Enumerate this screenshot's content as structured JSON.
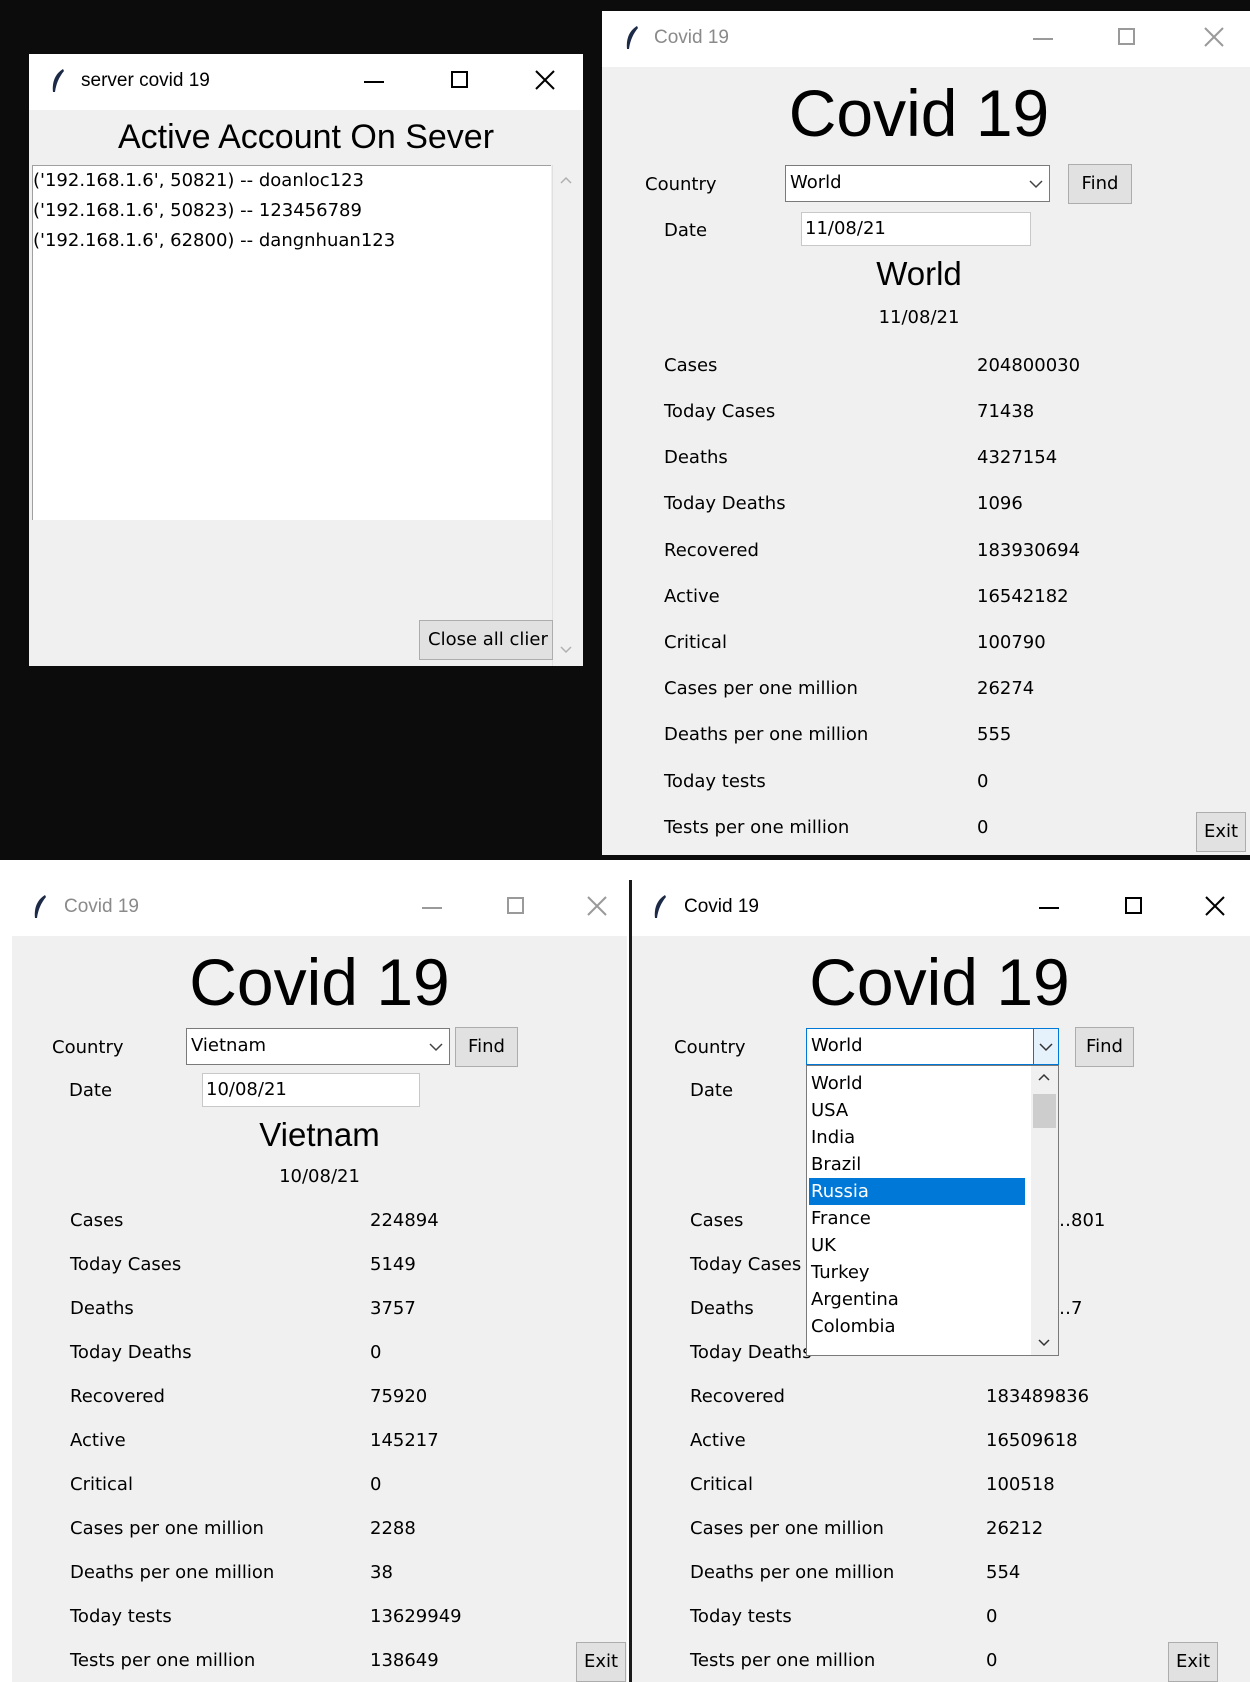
{
  "server_window": {
    "title": "server covid 19",
    "heading": "Active Account On Sever",
    "clients": [
      "('192.168.1.6', 50821) -- doanloc123",
      "('192.168.1.6', 50823) -- 123456789",
      "('192.168.1.6', 62800) -- dangnhuan123"
    ],
    "close_button": "Close all clier"
  },
  "client_top": {
    "title": "Covid 19",
    "heading": "Covid 19",
    "country_label": "Country",
    "country_value": "World",
    "find_button": "Find",
    "date_label": "Date",
    "date_value": "11/08/21",
    "result_name": "World",
    "result_date": "11/08/21",
    "stats": [
      {
        "label": "Cases",
        "value": "204800030"
      },
      {
        "label": "Today Cases",
        "value": "71438"
      },
      {
        "label": "Deaths",
        "value": "4327154"
      },
      {
        "label": "Today Deaths",
        "value": "1096"
      },
      {
        "label": "Recovered",
        "value": "183930694"
      },
      {
        "label": "Active",
        "value": "16542182"
      },
      {
        "label": "Critical",
        "value": "100790"
      },
      {
        "label": "Cases per one million",
        "value": "26274"
      },
      {
        "label": "Deaths per one million",
        "value": "555"
      },
      {
        "label": "Today tests",
        "value": "0"
      },
      {
        "label": "Tests per one million",
        "value": "0"
      }
    ],
    "exit_button": "Exit"
  },
  "client_bl": {
    "title": "Covid 19",
    "heading": "Covid 19",
    "country_label": "Country",
    "country_value": "Vietnam",
    "find_button": "Find",
    "date_label": "Date",
    "date_value": "10/08/21",
    "result_name": "Vietnam",
    "result_date": "10/08/21",
    "stats": [
      {
        "label": "Cases",
        "value": "224894"
      },
      {
        "label": "Today Cases",
        "value": "5149"
      },
      {
        "label": "Deaths",
        "value": "3757"
      },
      {
        "label": "Today Deaths",
        "value": "0"
      },
      {
        "label": "Recovered",
        "value": "75920"
      },
      {
        "label": "Active",
        "value": "145217"
      },
      {
        "label": "Critical",
        "value": "0"
      },
      {
        "label": "Cases per one million",
        "value": "2288"
      },
      {
        "label": "Deaths per one million",
        "value": "38"
      },
      {
        "label": "Today tests",
        "value": "13629949"
      },
      {
        "label": "Tests per one million",
        "value": "138649"
      }
    ],
    "exit_button": "Exit"
  },
  "client_br": {
    "title": "Covid 19",
    "heading": "Covid 19",
    "country_label": "Country",
    "country_value": "World",
    "find_button": "Find",
    "date_label": "Date",
    "dropdown_options": [
      "World",
      "USA",
      "India",
      "Brazil",
      "Russia",
      "France",
      "UK",
      "Turkey",
      "Argentina",
      "Colombia"
    ],
    "dropdown_selected": "Russia",
    "stats": [
      {
        "label": "Cases",
        "value": "…801"
      },
      {
        "label": "Today Cases",
        "value": ""
      },
      {
        "label": "Deaths",
        "value": "…7"
      },
      {
        "label": "Today Deaths",
        "value": ""
      },
      {
        "label": "Recovered",
        "value": "183489836"
      },
      {
        "label": "Active",
        "value": "16509618"
      },
      {
        "label": "Critical",
        "value": "100518"
      },
      {
        "label": "Cases per one million",
        "value": "26212"
      },
      {
        "label": "Deaths per one million",
        "value": "554"
      },
      {
        "label": "Today tests",
        "value": "0"
      },
      {
        "label": "Tests per one million",
        "value": "0"
      }
    ],
    "exit_button": "Exit"
  },
  "colors": {
    "window_bg": "#f0f0f0",
    "selection": "#0078d7",
    "desktop": "#0c0c0c"
  }
}
